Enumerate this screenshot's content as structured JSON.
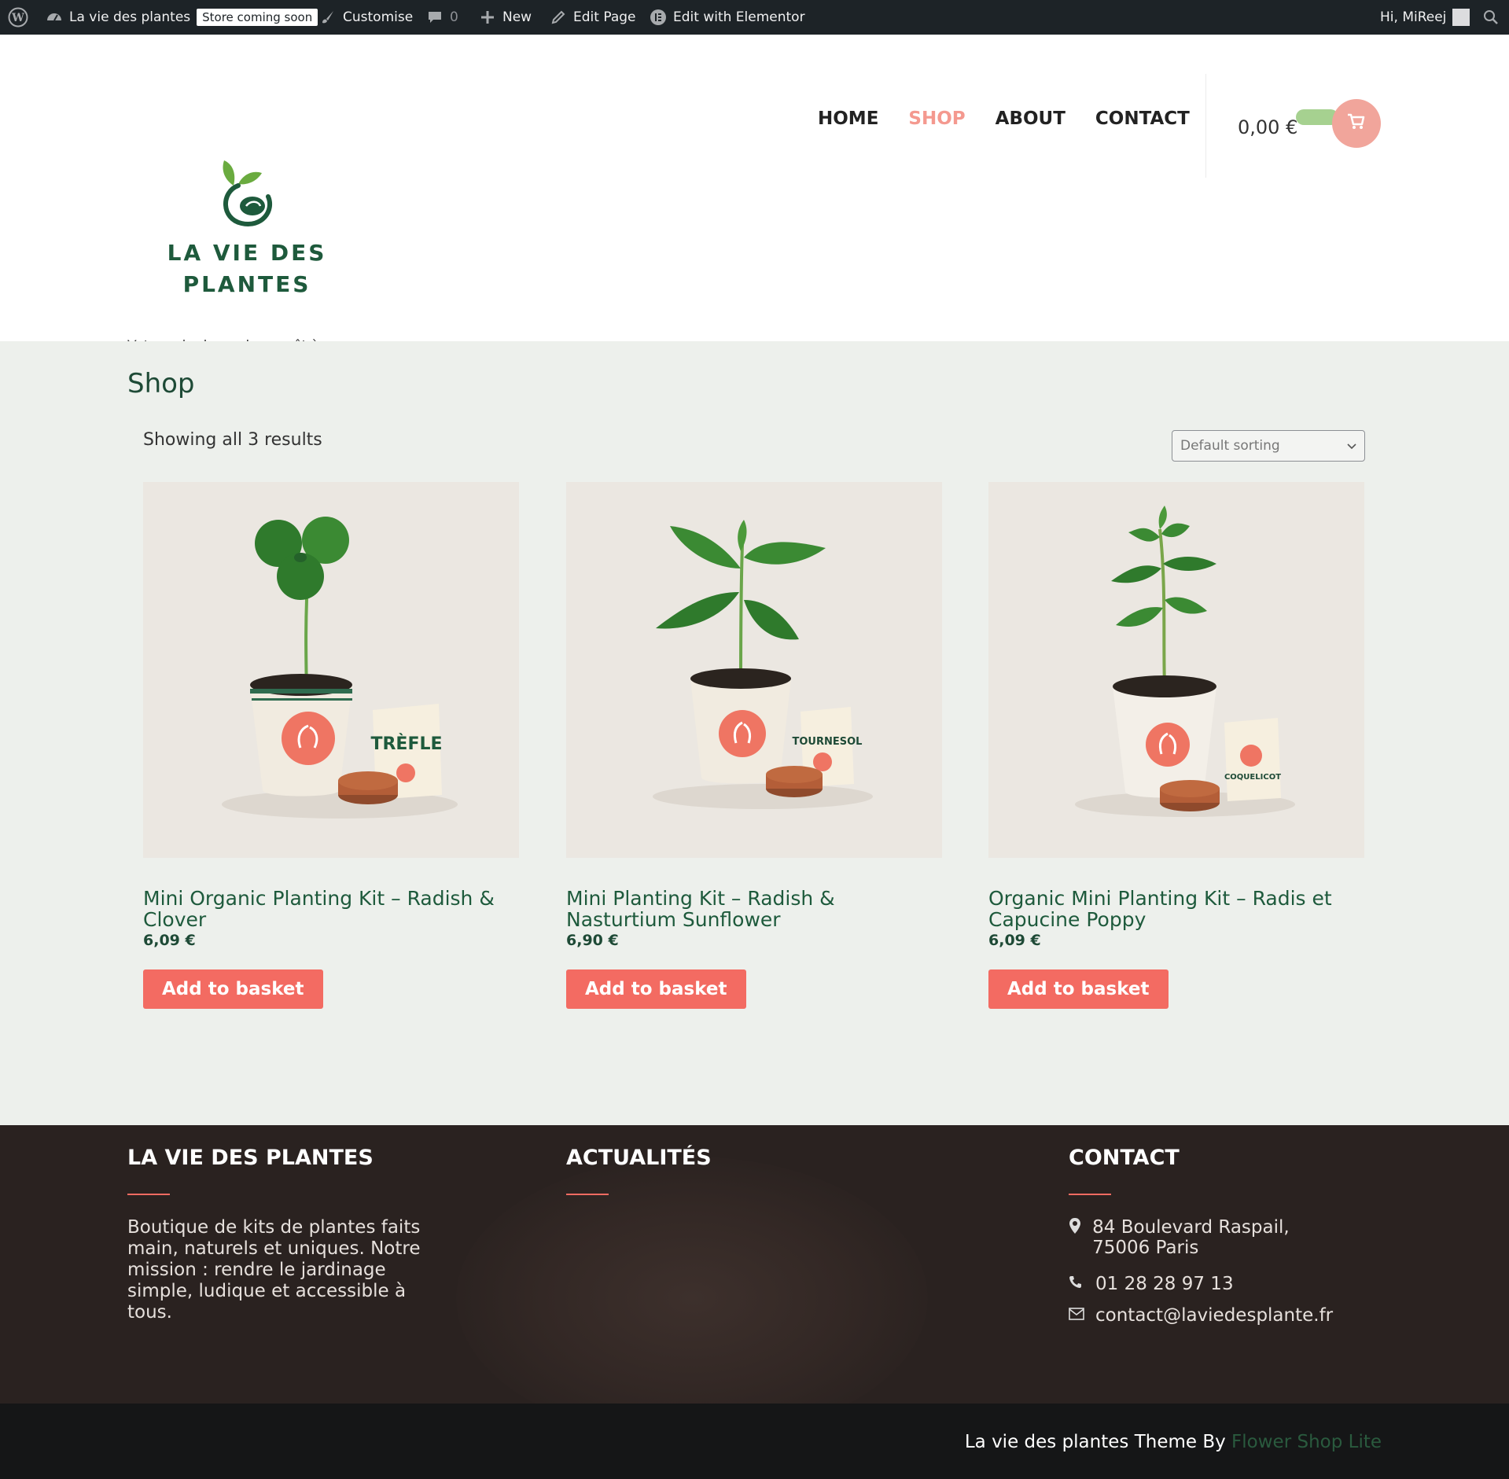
{
  "adminbar": {
    "site_name": "La vie des plantes",
    "store_badge": "Store coming soon",
    "customise": "Customise",
    "comments_count": "0",
    "new": "New",
    "edit_page": "Edit Page",
    "edit_elementor": "Edit with Elementor",
    "greeting": "Hi, MiReej"
  },
  "nav": {
    "items": [
      {
        "label": "HOME",
        "active": false
      },
      {
        "label": "SHOP",
        "active": true
      },
      {
        "label": "ABOUT",
        "active": false
      },
      {
        "label": "CONTACT",
        "active": false
      }
    ]
  },
  "cart": {
    "total": "0,00 €"
  },
  "brand": {
    "logo_line1": "LA VIE DES",
    "logo_line2": "PLANTES",
    "tagline": "Votre coin de verdure, prêt à pousser"
  },
  "shop": {
    "title": "Shop",
    "results": "Showing all 3 results",
    "sorting": "Default sorting",
    "products": [
      {
        "name": "Mini Organic Planting Kit – Radish & Clover",
        "price": "6,09 €",
        "button": "Add to basket",
        "packet": "TRÈFLE"
      },
      {
        "name": "Mini Planting Kit – Radish & Nasturtium Sunflower",
        "price": "6,90 €",
        "button": "Add to basket",
        "packet": "TOURNESOL"
      },
      {
        "name": "Organic Mini Planting Kit – Radis et Capucine Poppy",
        "price": "6,09 €",
        "button": "Add to basket",
        "packet": "COQUELICOT"
      }
    ]
  },
  "footer": {
    "col1_title": "LA VIE DES PLANTES",
    "col1_text": "Boutique de kits de plantes faits main, naturels et uniques. Notre mission : rendre le jardinage simple, ludique et accessible à tous.",
    "col2_title": "ACTUALITÉS",
    "col3_title": "CONTACT",
    "address": "84 Boulevard Raspail, 75006 Paris",
    "phone": "01 28 28 97 13",
    "email": "contact@laviedesplante.fr"
  },
  "credit": {
    "text": "La vie des plantes Theme By ",
    "link": "Flower Shop Lite"
  },
  "colors": {
    "accent": "#f36b62",
    "brand_green": "#1e5a3c",
    "nav_active": "#f4998f"
  }
}
